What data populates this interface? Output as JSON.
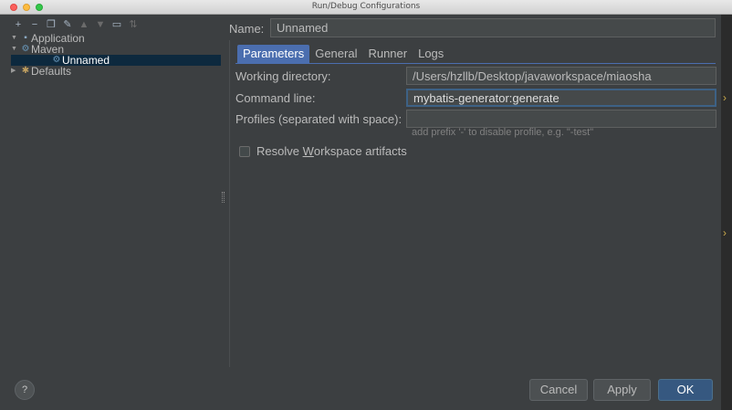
{
  "window": {
    "title": "Run/Debug Configurations"
  },
  "toolbar": {
    "icons": [
      "add-icon",
      "remove-icon",
      "copy-icon",
      "wrench-icon",
      "move-up-icon",
      "move-down-icon",
      "folder-icon",
      "sort-icon"
    ]
  },
  "tree": {
    "items": [
      {
        "label": "Application",
        "level": 0,
        "expanded": true,
        "icon": "application-icon"
      },
      {
        "label": "Maven",
        "level": 0,
        "expanded": true,
        "icon": "maven-icon"
      },
      {
        "label": "Unnamed",
        "level": 1,
        "selected": true,
        "icon": "maven-config-icon"
      },
      {
        "label": "Defaults",
        "level": 0,
        "expanded": false,
        "icon": "defaults-icon"
      }
    ]
  },
  "form": {
    "name_label": "Name:",
    "name_value": "Unnamed",
    "tabs": [
      {
        "label": "Parameters",
        "active": true
      },
      {
        "label": "General",
        "active": false
      },
      {
        "label": "Runner",
        "active": false
      },
      {
        "label": "Logs",
        "active": false
      }
    ],
    "working_dir_label": "Working directory:",
    "working_dir_value": "/Users/hzllb/Desktop/javaworkspace/miaosha",
    "command_line_label": "Command line:",
    "command_line_value": "mybatis-generator:generate",
    "profiles_label": "Profiles (separated with space):",
    "profiles_value": "",
    "profiles_hint": "add prefix '-' to disable profile, e.g. \"-test\"",
    "resolve_pre": "Resolve ",
    "resolve_mnemonic": "W",
    "resolve_post": "orkspace artifacts",
    "resolve_checked": false
  },
  "footer": {
    "help_label": "?",
    "cancel_label": "Cancel",
    "apply_label": "Apply",
    "ok_label": "OK"
  },
  "colors": {
    "background": "#3c3f41",
    "selection": "#0d293e",
    "tab_active": "#4b6eaf",
    "default_button": "#365880"
  }
}
